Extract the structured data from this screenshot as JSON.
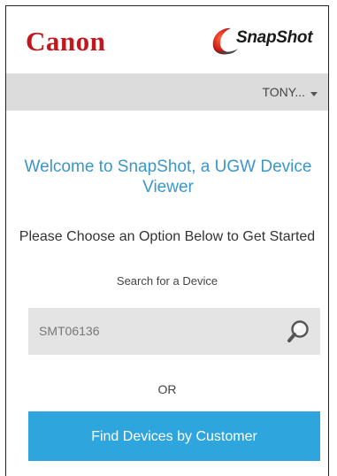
{
  "header": {
    "brand": "Canon",
    "app_logo_text": "SnapShot"
  },
  "user_menu": {
    "label": "TONY...",
    "icon": "chevron-down-icon"
  },
  "main": {
    "welcome": "Welcome to SnapShot, a UGW Device Viewer",
    "instruction": "Please Choose an Option Below to Get Started",
    "search_label": "Search for a Device",
    "search_value": "SMT06136",
    "search_icon": "magnifier-icon",
    "or_text": "OR",
    "find_button": "Find Devices by Customer"
  },
  "colors": {
    "canon_red": "#c4161c",
    "accent_blue": "#2ea5dc",
    "title_blue": "#3a97c9"
  }
}
